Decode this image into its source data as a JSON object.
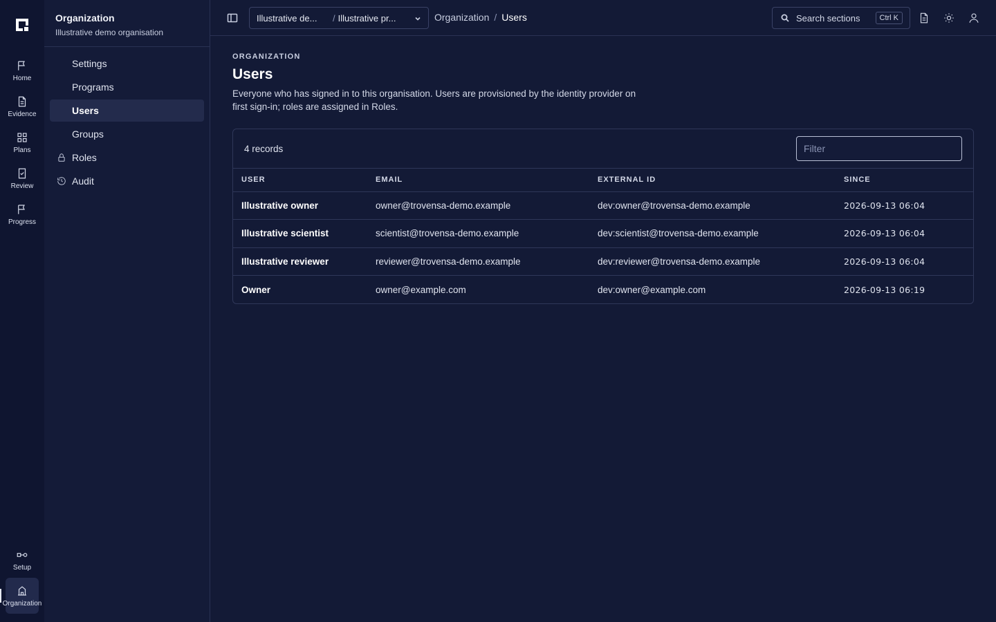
{
  "rail": {
    "items": [
      {
        "label": "Home",
        "icon": "flag-icon"
      },
      {
        "label": "Evidence",
        "icon": "document-icon"
      },
      {
        "label": "Plans",
        "icon": "grid-icon"
      },
      {
        "label": "Review",
        "icon": "checklist-icon"
      },
      {
        "label": "Progress",
        "icon": "flag-icon"
      }
    ],
    "bottom": [
      {
        "label": "Setup",
        "icon": "setup-icon"
      },
      {
        "label": "Organization",
        "icon": "building-icon"
      }
    ]
  },
  "sidebar": {
    "title": "Organization",
    "subtitle": "Illustrative demo organisation",
    "items": [
      {
        "label": "Settings"
      },
      {
        "label": "Programs"
      },
      {
        "label": "Users"
      },
      {
        "label": "Groups"
      },
      {
        "label": "Roles",
        "icon": "lock-icon"
      },
      {
        "label": "Audit",
        "icon": "history-icon"
      }
    ]
  },
  "topbar": {
    "context_org": "Illustrative de...",
    "context_program": "Illustrative pr...",
    "breadcrumb": [
      "Organization",
      "Users"
    ],
    "search_label": "Search sections",
    "search_shortcut": "Ctrl K"
  },
  "main": {
    "eyebrow": "ORGANIZATION",
    "title": "Users",
    "description": "Everyone who has signed in to this organisation. Users are provisioned by the identity provider on first sign-in; roles are assigned in Roles.",
    "record_count": "4 records",
    "filter_placeholder": "Filter",
    "columns": [
      "USER",
      "EMAIL",
      "EXTERNAL ID",
      "SINCE"
    ],
    "rows": [
      {
        "user": "Illustrative owner",
        "email": "owner@trovensa-demo.example",
        "external_id": "dev:owner@trovensa-demo.example",
        "since": "2026-09-13 06:04"
      },
      {
        "user": "Illustrative scientist",
        "email": "scientist@trovensa-demo.example",
        "external_id": "dev:scientist@trovensa-demo.example",
        "since": "2026-09-13 06:04"
      },
      {
        "user": "Illustrative reviewer",
        "email": "reviewer@trovensa-demo.example",
        "external_id": "dev:reviewer@trovensa-demo.example",
        "since": "2026-09-13 06:04"
      },
      {
        "user": "Owner",
        "email": "owner@example.com",
        "external_id": "dev:owner@example.com",
        "since": "2026-09-13 06:19"
      }
    ]
  }
}
